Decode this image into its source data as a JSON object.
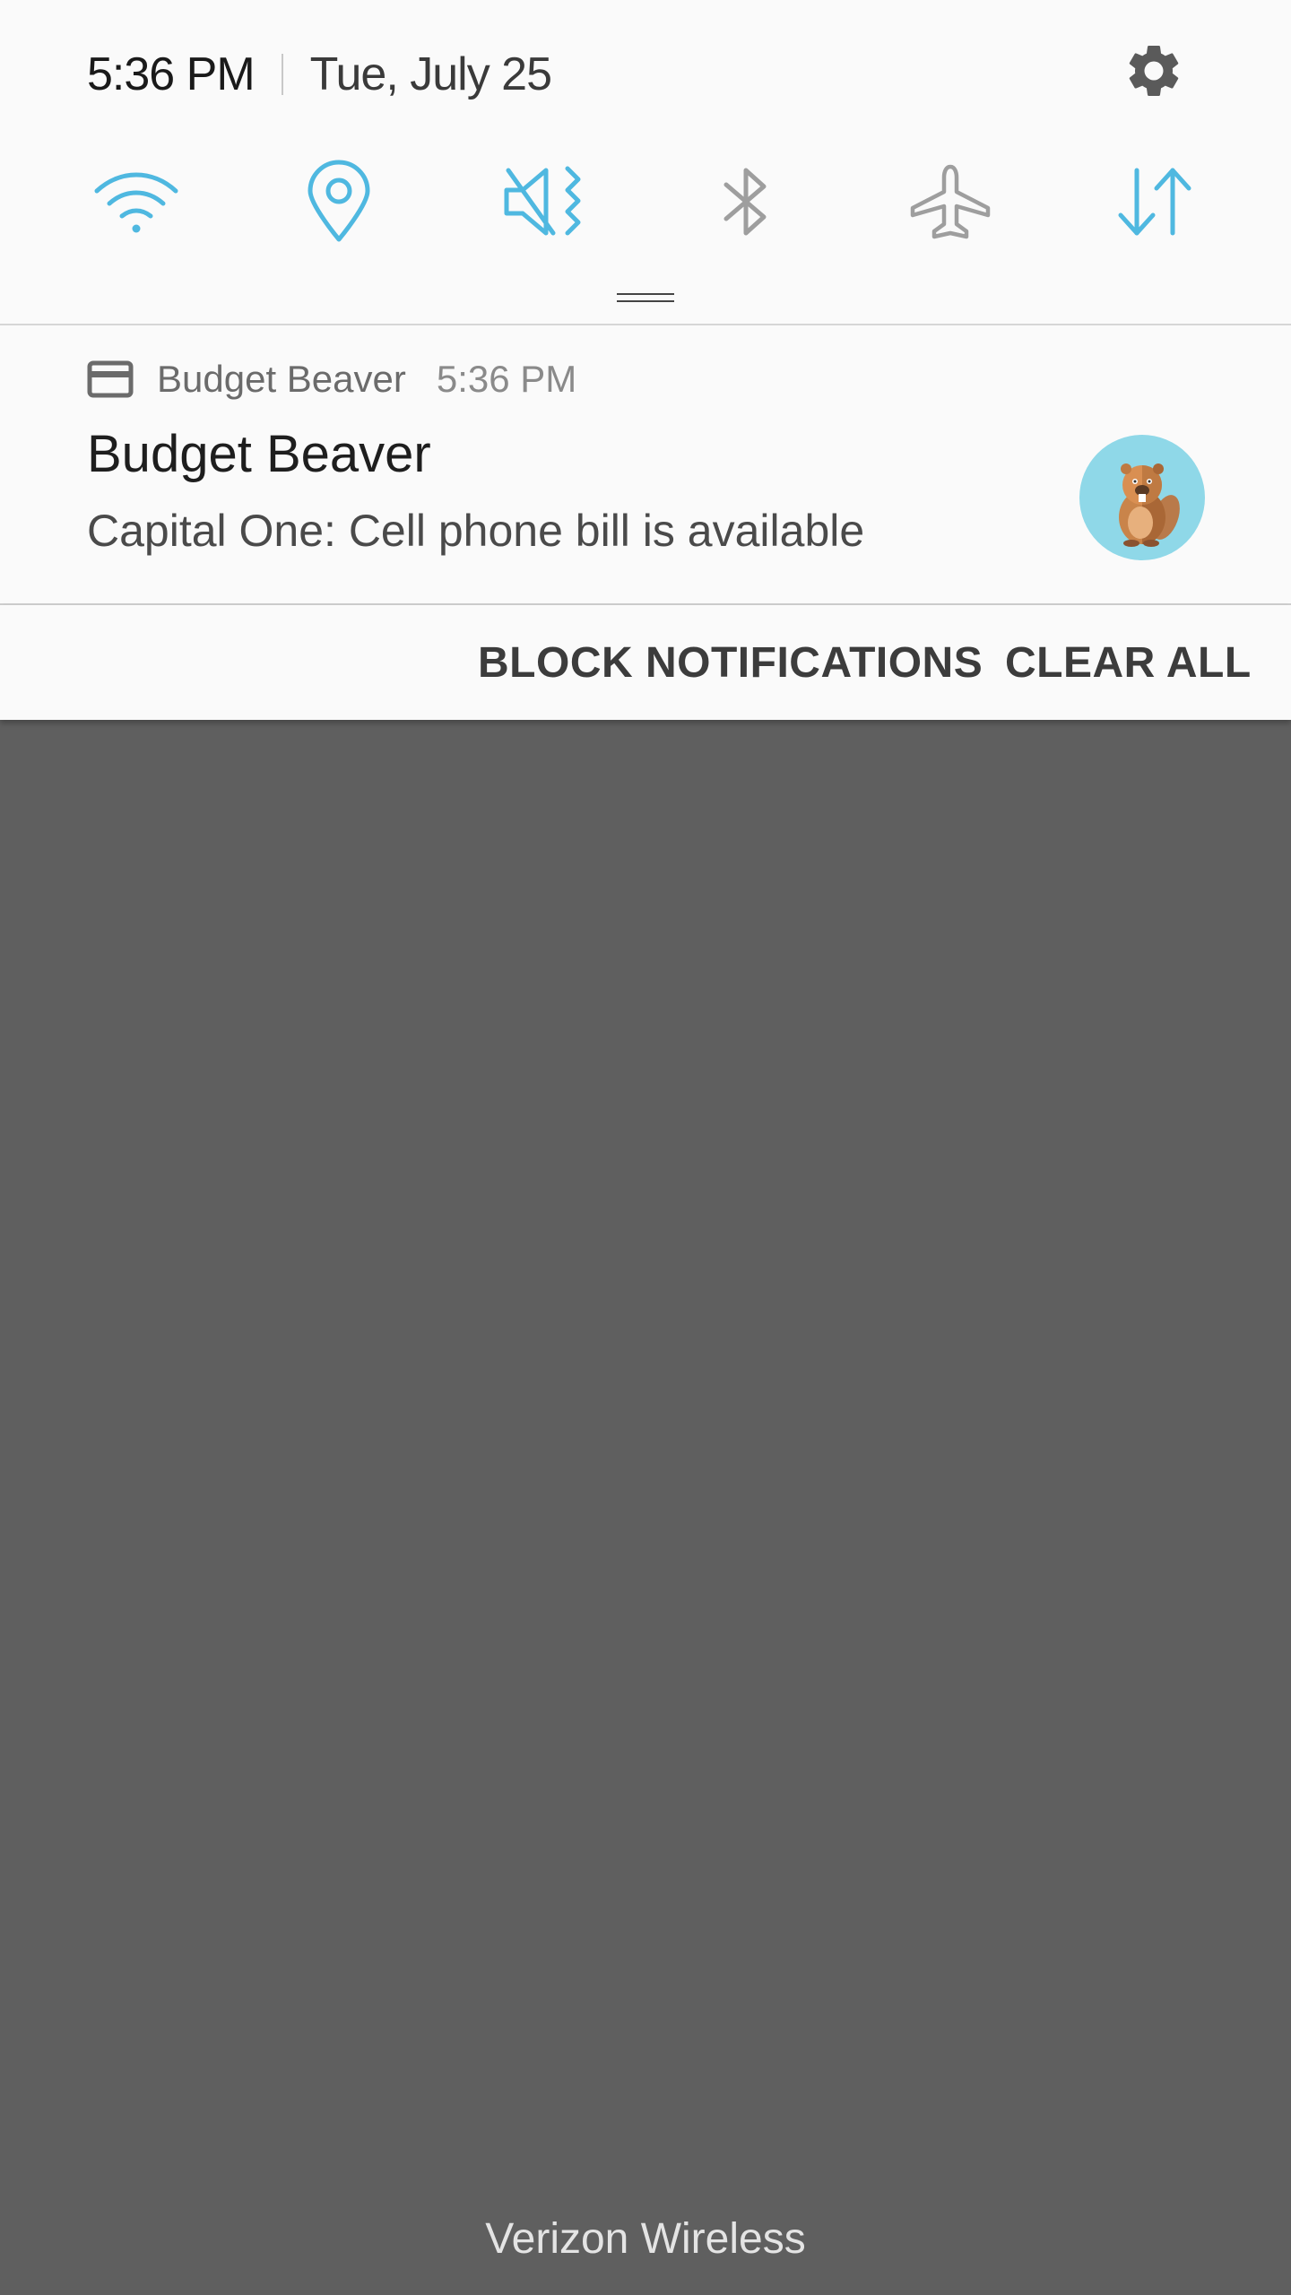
{
  "status": {
    "time": "5:36 PM",
    "date": "Tue, July 25"
  },
  "quick_toggles": [
    {
      "name": "wifi-icon",
      "color": "#4fb8e0",
      "active": true
    },
    {
      "name": "location-icon",
      "color": "#4fb8e0",
      "active": true
    },
    {
      "name": "vibrate-mute-icon",
      "color": "#4fb8e0",
      "active": true
    },
    {
      "name": "bluetooth-icon",
      "color": "#9e9e9e",
      "active": false
    },
    {
      "name": "airplane-icon",
      "color": "#9e9e9e",
      "active": false
    },
    {
      "name": "mobile-data-icon",
      "color": "#4fb8e0",
      "active": true
    }
  ],
  "notification": {
    "app_name": "Budget Beaver",
    "time": "5:36 PM",
    "title": "Budget Beaver",
    "text": "Capital One: Cell phone bill is available",
    "avatar_icon": "beaver-avatar-icon"
  },
  "actions": {
    "block_label": "BLOCK NOTIFICATIONS",
    "clear_label": "CLEAR ALL"
  },
  "carrier": "Verizon Wireless",
  "colors": {
    "accent": "#4fb8e0",
    "inactive": "#9e9e9e",
    "panel_bg": "#fafafa",
    "scrim": "#5f5f5f"
  }
}
